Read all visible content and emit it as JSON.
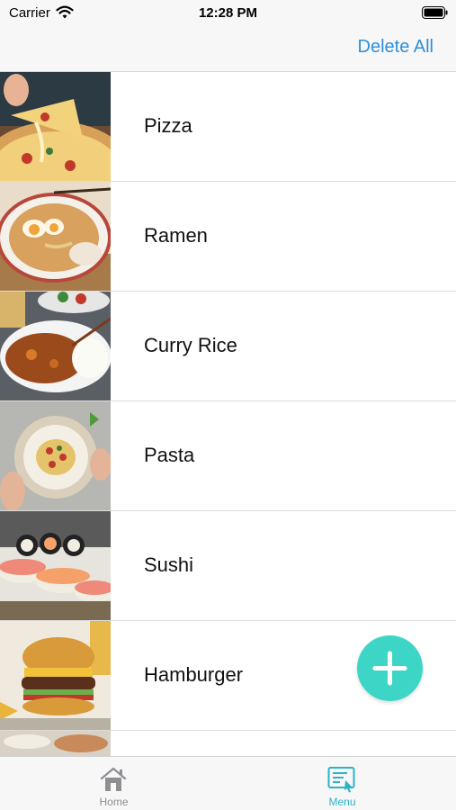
{
  "status_bar": {
    "carrier": "Carrier",
    "time": "12:28 PM"
  },
  "nav": {
    "delete_all": "Delete All"
  },
  "items": [
    {
      "label": "Pizza",
      "image": "pizza-photo"
    },
    {
      "label": "Ramen",
      "image": "ramen-photo"
    },
    {
      "label": "Curry Rice",
      "image": "curry-rice-photo"
    },
    {
      "label": "Pasta",
      "image": "pasta-photo"
    },
    {
      "label": "Sushi",
      "image": "sushi-photo"
    },
    {
      "label": "Hamburger",
      "image": "hamburger-photo"
    },
    {
      "label": "",
      "image": "partial-photo"
    }
  ],
  "fab": {
    "icon": "plus-icon",
    "color": "#3dd6c6"
  },
  "tabs": [
    {
      "label": "Home",
      "icon": "home-icon",
      "active": false
    },
    {
      "label": "Menu",
      "icon": "menu-icon",
      "active": true
    }
  ],
  "colors": {
    "accent": "#2c8fdc",
    "active_tab": "#2db3c9",
    "inactive_tab": "#8e8e93"
  }
}
